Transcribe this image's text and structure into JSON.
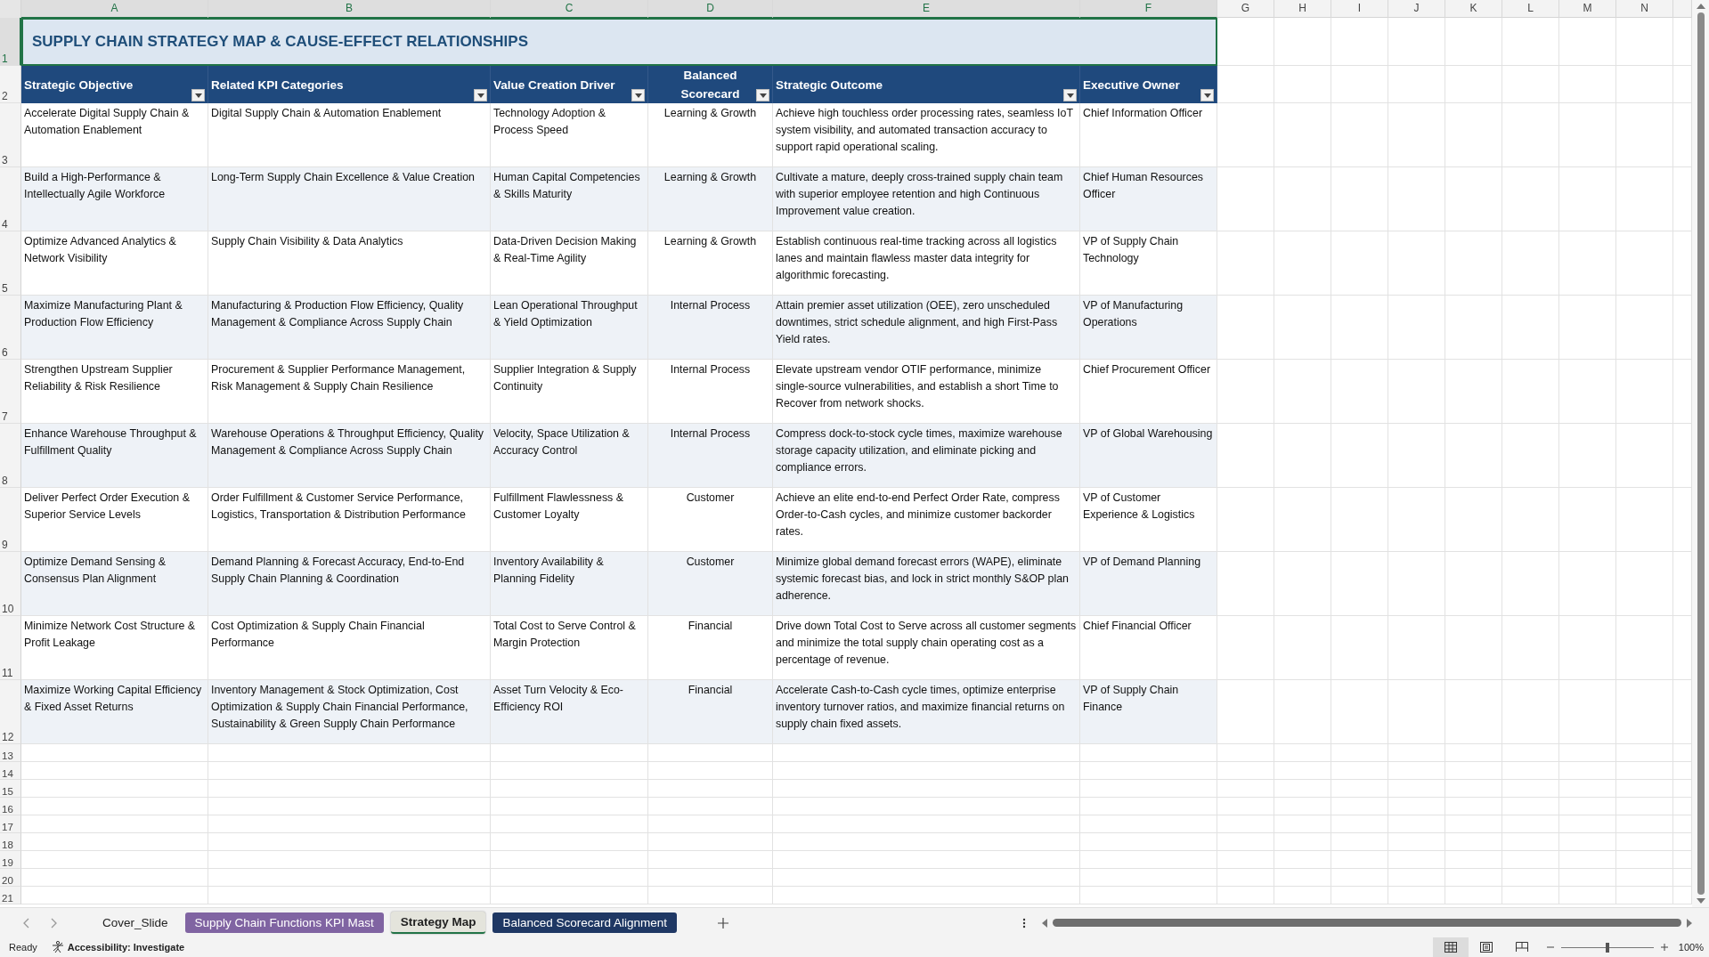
{
  "column_letters": [
    {
      "label": "A",
      "selected": true
    },
    {
      "label": "B",
      "selected": true
    },
    {
      "label": "C",
      "selected": true
    },
    {
      "label": "D",
      "selected": true
    },
    {
      "label": "E",
      "selected": true
    },
    {
      "label": "F",
      "selected": true
    },
    {
      "label": "G",
      "selected": false
    },
    {
      "label": "H",
      "selected": false
    },
    {
      "label": "I",
      "selected": false
    },
    {
      "label": "J",
      "selected": false
    },
    {
      "label": "K",
      "selected": false
    },
    {
      "label": "L",
      "selected": false
    },
    {
      "label": "M",
      "selected": false
    },
    {
      "label": "N",
      "selected": false
    }
  ],
  "title_row": {
    "number": "1",
    "selected": true,
    "title": "SUPPLY CHAIN STRATEGY MAP & CAUSE-EFFECT RELATIONSHIPS"
  },
  "header_row": {
    "number": "2",
    "selected": false,
    "headers": [
      "Strategic Objective",
      "Related KPI Categories",
      "Value Creation Driver",
      "Balanced Scorecard",
      "Strategic Outcome",
      "Executive Owner"
    ]
  },
  "rows": [
    {
      "number": "3",
      "selected": false,
      "cells": [
        "Accelerate Digital Supply Chain & Automation Enablement",
        "Digital Supply Chain & Automation Enablement",
        "Technology Adoption & Process Speed",
        "Learning & Growth",
        "Achieve high touchless order processing rates, seamless IoT system visibility, and automated transaction accuracy to support rapid operational scaling.",
        "Chief Information Officer"
      ]
    },
    {
      "number": "4",
      "selected": false,
      "cells": [
        "Build a High-Performance & Intellectually Agile Workforce",
        "Long-Term Supply Chain Excellence & Value Creation",
        "Human Capital Competencies & Skills Maturity",
        "Learning & Growth",
        "Cultivate a mature, deeply cross-trained supply chain team with superior employee retention and high Continuous Improvement value creation.",
        "Chief Human Resources Officer"
      ]
    },
    {
      "number": "5",
      "selected": false,
      "cells": [
        "Optimize Advanced Analytics & Network Visibility",
        "Supply Chain Visibility & Data Analytics",
        "Data-Driven Decision Making & Real-Time Agility",
        "Learning & Growth",
        "Establish continuous real-time tracking across all logistics lanes and maintain flawless master data integrity for algorithmic forecasting.",
        "VP of Supply Chain Technology"
      ]
    },
    {
      "number": "6",
      "selected": false,
      "cells": [
        "Maximize Manufacturing Plant & Production Flow Efficiency",
        "Manufacturing & Production Flow Efficiency, Quality Management & Compliance Across Supply Chain",
        "Lean Operational Throughput & Yield Optimization",
        "Internal Process",
        "Attain premier asset utilization (OEE), zero unscheduled downtimes, strict schedule alignment, and high First-Pass Yield rates.",
        "VP of Manufacturing Operations"
      ]
    },
    {
      "number": "7",
      "selected": false,
      "cells": [
        "Strengthen Upstream Supplier Reliability & Risk Resilience",
        "Procurement & Supplier Performance Management, Risk Management & Supply Chain Resilience",
        "Supplier Integration & Supply Continuity",
        "Internal Process",
        "Elevate upstream vendor OTIF performance, minimize single-source vulnerabilities, and establish a short Time to Recover from network shocks.",
        "Chief Procurement Officer"
      ]
    },
    {
      "number": "8",
      "selected": false,
      "cells": [
        "Enhance Warehouse Throughput & Fulfillment Quality",
        "Warehouse Operations & Throughput Efficiency, Quality Management & Compliance Across Supply Chain",
        "Velocity, Space Utilization & Accuracy Control",
        "Internal Process",
        "Compress dock-to-stock cycle times, maximize warehouse storage capacity utilization, and eliminate picking and compliance errors.",
        "VP of Global Warehousing"
      ]
    },
    {
      "number": "9",
      "selected": false,
      "cells": [
        "Deliver Perfect Order Execution & Superior Service Levels",
        "Order Fulfillment & Customer Service Performance, Logistics, Transportation & Distribution Performance",
        "Fulfillment Flawlessness & Customer Loyalty",
        "Customer",
        "Achieve an elite end-to-end Perfect Order Rate, compress Order-to-Cash cycles, and minimize customer backorder rates.",
        "VP of Customer Experience & Logistics"
      ]
    },
    {
      "number": "10",
      "selected": false,
      "cells": [
        "Optimize Demand Sensing & Consensus Plan Alignment",
        "Demand Planning & Forecast Accuracy, End-to-End Supply Chain Planning & Coordination",
        "Inventory Availability & Planning Fidelity",
        "Customer",
        "Minimize global demand forecast errors (WAPE), eliminate systemic forecast bias, and lock in strict monthly S&OP plan adherence.",
        "VP of Demand Planning"
      ]
    },
    {
      "number": "11",
      "selected": false,
      "cells": [
        "Minimize Network Cost Structure & Profit Leakage",
        "Cost Optimization & Supply Chain Financial Performance",
        "Total Cost to Serve Control & Margin Protection",
        "Financial",
        "Drive down Total Cost to Serve across all customer segments and minimize the total supply chain operating cost as a percentage of revenue.",
        "Chief Financial Officer"
      ]
    },
    {
      "number": "12",
      "selected": false,
      "cells": [
        "Maximize Working Capital Efficiency & Fixed Asset Returns",
        "Inventory Management & Stock Optimization, Cost Optimization & Supply Chain Financial Performance, Sustainability & Green Supply Chain Performance",
        "Asset Turn Velocity & Eco-Efficiency ROI",
        "Financial",
        "Accelerate Cash-to-Cash cycle times, optimize enterprise inventory turnover ratios, and maximize financial returns on supply chain fixed assets.",
        "VP of Supply Chain Finance"
      ]
    }
  ],
  "empty_rows": [
    "13",
    "14",
    "15",
    "16",
    "17",
    "18",
    "19",
    "20",
    "21"
  ],
  "tabs": [
    {
      "label": "Cover_Slide",
      "selected": false
    },
    {
      "label": "Supply Chain Functions KPI Mast",
      "selected": false,
      "color": "#8064a2"
    },
    {
      "label": "Strategy Map",
      "selected": true
    },
    {
      "label": "Balanced Scorecard Alignment",
      "selected": false,
      "color": "#1f3864"
    }
  ],
  "status_bar": {
    "mode": "Ready",
    "accessibility": "Accessibility: Investigate",
    "zoom_slider": {
      "level": 0.5
    },
    "zoom": "100%"
  }
}
